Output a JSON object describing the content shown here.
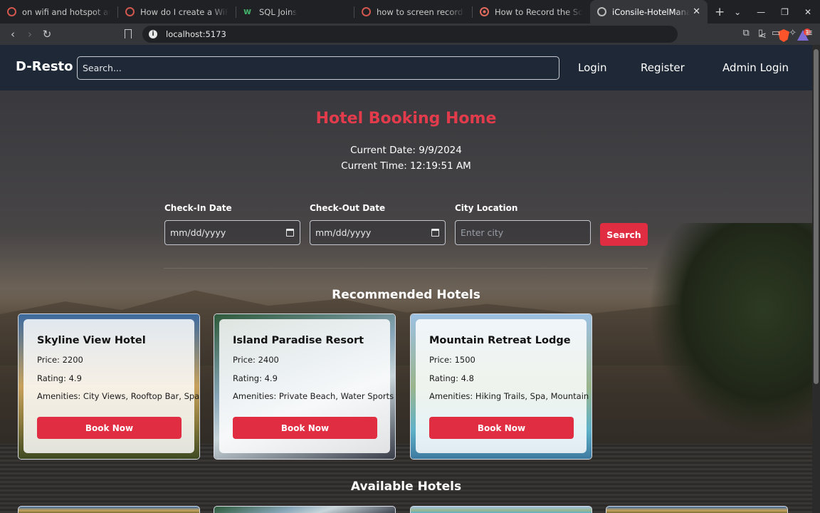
{
  "browser": {
    "tabs": [
      {
        "title": "on wifi and hotspot and",
        "active": false
      },
      {
        "title": "How do I create a WiFi",
        "active": false
      },
      {
        "title": "SQL Joins",
        "active": false
      },
      {
        "title": "how to screen record in",
        "active": false
      },
      {
        "title": "How to Record the Scre",
        "active": false
      },
      {
        "title": "iConsile-HotelManag",
        "active": true
      }
    ],
    "url": "localhost:5173",
    "rewards_badge": "1"
  },
  "navbar": {
    "brand": "D-Resto",
    "search_placeholder": "Search...",
    "login": "Login",
    "register": "Register",
    "admin_login": "Admin Login"
  },
  "main": {
    "title": "Hotel Booking Home",
    "current_date": "Current Date: 9/9/2024",
    "current_time": "Current Time: 12:19:51 AM"
  },
  "search_form": {
    "checkin_label": "Check-In Date",
    "checkin_value": "mm/dd/yyyy",
    "checkout_label": "Check-Out Date",
    "checkout_value": "mm/dd/yyyy",
    "city_label": "City Location",
    "city_placeholder": "Enter city",
    "search_button": "Search"
  },
  "recommended": {
    "heading": "Recommended Hotels",
    "hotels": [
      {
        "name": "Skyline View Hotel",
        "price": "Price: 2200",
        "rating": "Rating: 4.9",
        "amenities": "Amenities: City Views, Rooftop Bar, Spa",
        "book": "Book Now"
      },
      {
        "name": "Island Paradise Resort",
        "price": "Price: 2400",
        "rating": "Rating: 4.9",
        "amenities": "Amenities: Private Beach, Water Sports",
        "book": "Book Now"
      },
      {
        "name": "Mountain Retreat Lodge",
        "price": "Price: 1500",
        "rating": "Rating: 4.8",
        "amenities": "Amenities: Hiking Trails, Spa, Mountain",
        "book": "Book Now"
      }
    ]
  },
  "available": {
    "heading": "Available Hotels"
  },
  "colors": {
    "accent": "#e02d42",
    "title": "#e23b4c",
    "navbar": "#1e2836"
  }
}
